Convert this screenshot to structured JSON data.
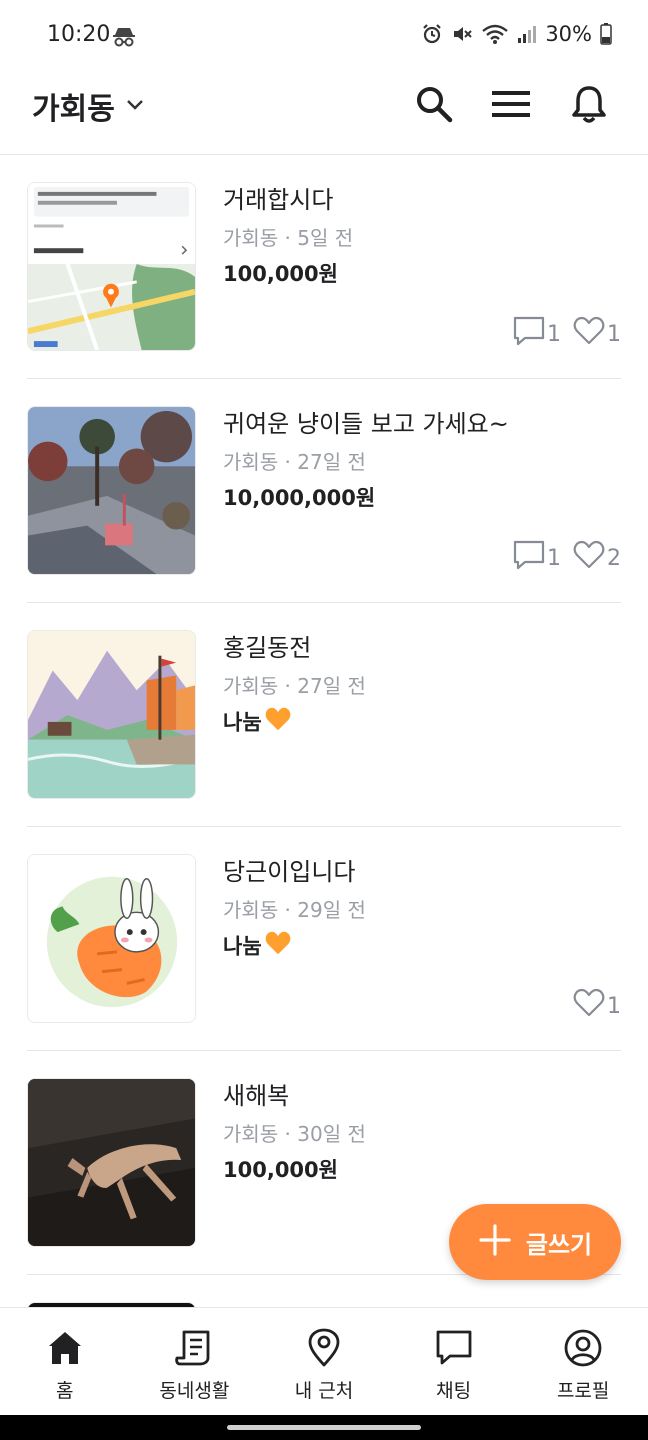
{
  "status_bar": {
    "time": "10:20",
    "battery": "30%"
  },
  "header": {
    "location": "가회동",
    "icons": [
      "chevron-down-icon",
      "search-icon",
      "menu-icon",
      "bell-icon"
    ]
  },
  "items": [
    {
      "title": "거래합시다",
      "location": "가회동",
      "age": "5일 전",
      "price": "100,000원",
      "comments": "1",
      "likes": "1",
      "thumb": "map-screenshot"
    },
    {
      "title": "귀여운 냥이들 보고 가세요~",
      "location": "가회동",
      "age": "27일 전",
      "price": "10,000,000원",
      "comments": "1",
      "likes": "2",
      "thumb": "garden-photo"
    },
    {
      "title": "홍길동전",
      "location": "가회동",
      "age": "27일 전",
      "price": "나눔",
      "thumb": "ship-painting"
    },
    {
      "title": "당근이입니다",
      "location": "가회동",
      "age": "29일 전",
      "price": "나눔",
      "likes": "1",
      "thumb": "rabbit-carrot-illustration"
    },
    {
      "title": "새해복",
      "location": "가회동",
      "age": "30일 전",
      "price": "100,000원",
      "thumb": "deer-photo"
    }
  ],
  "fab": {
    "label": "글쓰기"
  },
  "bottom_nav": [
    {
      "label": "홈",
      "icon": "home-icon",
      "active": true
    },
    {
      "label": "동네생활",
      "icon": "neighborhood-icon"
    },
    {
      "label": "내 근처",
      "icon": "location-pin-icon"
    },
    {
      "label": "채팅",
      "icon": "chat-icon"
    },
    {
      "label": "프로필",
      "icon": "profile-icon"
    }
  ],
  "colors": {
    "accent": "#ff8a3d",
    "text": "#212124",
    "muted": "#9a9ea6",
    "divider": "#e6e6e6"
  }
}
